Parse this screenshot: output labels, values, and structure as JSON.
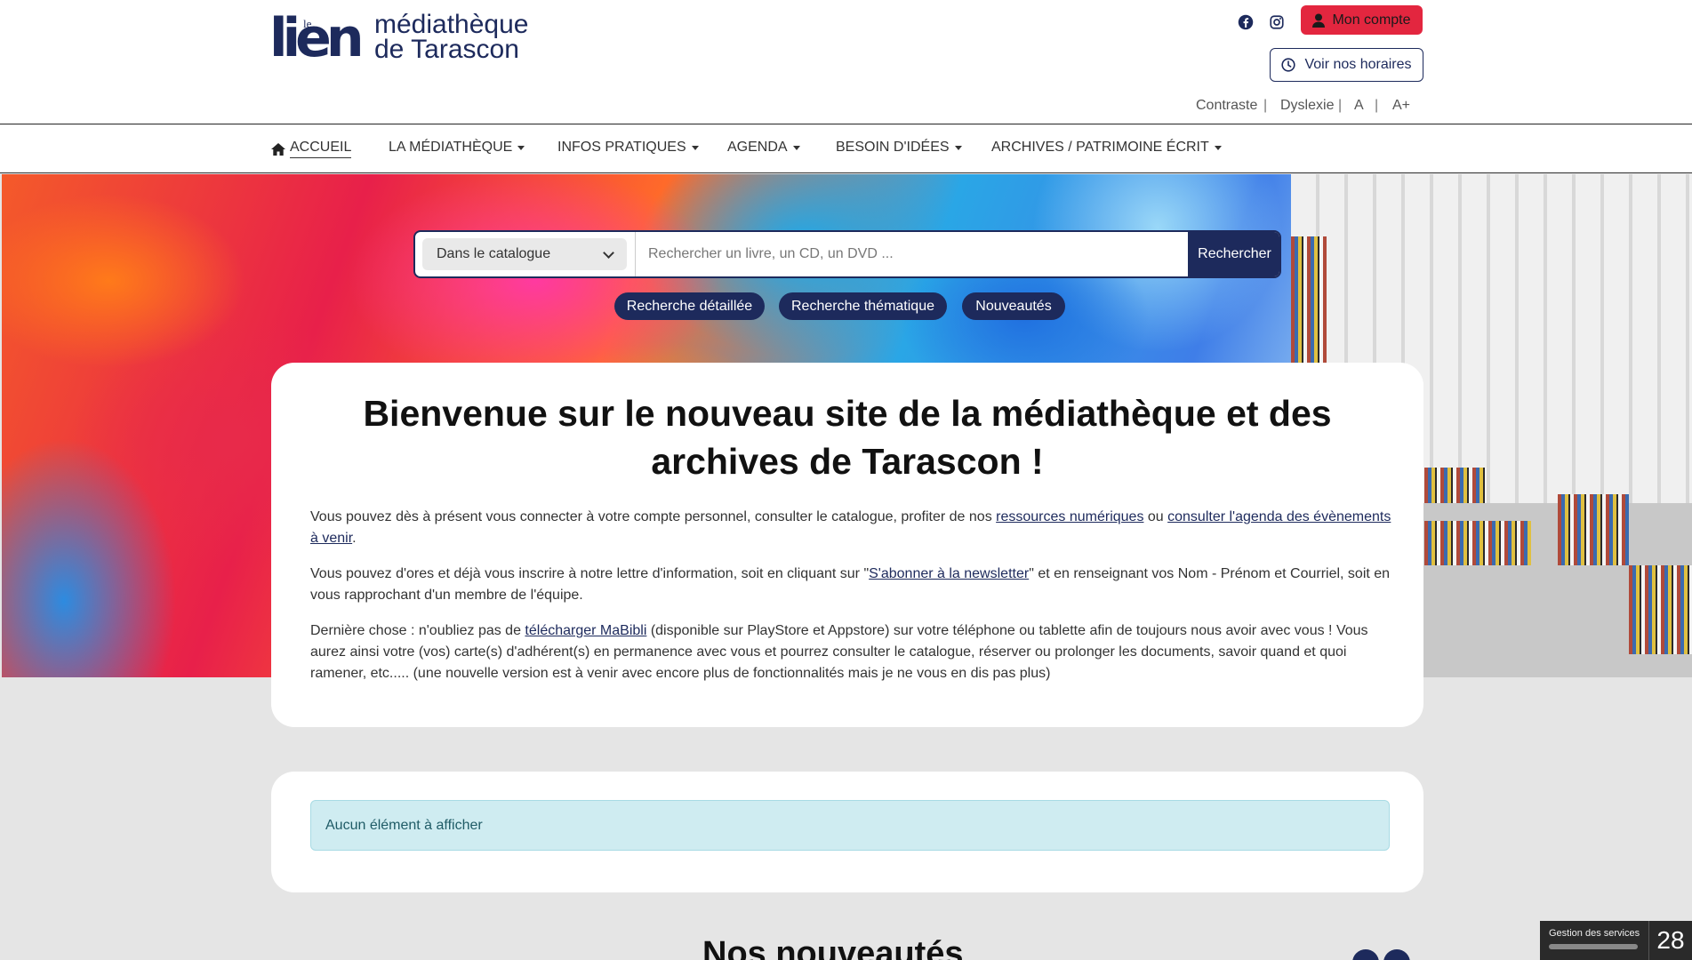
{
  "header": {
    "logo": {
      "le": "le",
      "lien": "lien",
      "line1": "médiathèque",
      "line2": "de Tarascon"
    },
    "social": [
      {
        "icon": "facebook-icon"
      },
      {
        "icon": "instagram-icon"
      }
    ],
    "account_label": "Mon compte",
    "hours_label": "Voir nos horaires",
    "accessibility": {
      "contrast": "Contraste",
      "dyslexia": "Dyslexie",
      "font_small": "A",
      "font_large": "A+",
      "separator": "|"
    }
  },
  "nav": {
    "items": [
      {
        "label": "ACCUEIL",
        "active": true
      },
      {
        "label": "LA MÉDIATHÈQUE"
      },
      {
        "label": "INFOS PRATIQUES"
      },
      {
        "label": "AGENDA"
      },
      {
        "label": "BESOIN D'IDÉES"
      },
      {
        "label": "ARCHIVES / PATRIMOINE ÉCRIT"
      }
    ]
  },
  "search": {
    "scope": "Dans le catalogue",
    "placeholder": "Rechercher un livre, un CD, un DVD ...",
    "button": "Rechercher",
    "pills": [
      "Recherche détaillée",
      "Recherche thématique",
      "Nouveautés"
    ]
  },
  "welcome": {
    "title": "Bienvenue sur le nouveau site de la médiathèque et des archives de Tarascon !",
    "p1": {
      "a": "Vous pouvez dès à présent vous connecter à votre compte personnel, consulter le catalogue, profiter de nos ",
      "link1": "ressources numériques",
      "b": " ou ",
      "link2": "consulter l'agenda des évènements à venir",
      "c": "."
    },
    "p2": {
      "a": "Vous pouvez d'ores et déjà vous inscrire à notre lettre d'information, soit en cliquant sur \"",
      "link": "S'abonner à la newsletter",
      "b": "\" et en renseignant vos Nom - Prénom et Courriel, soit en vous rapprochant d'un membre de l'équipe."
    },
    "p3": {
      "a": "Dernière chose : n'oubliez pas de ",
      "link": "télécharger MaBibli",
      "b": " (disponible sur PlayStore et Appstore) sur votre téléphone ou tablette afin de toujours nous avoir avec vous ! Vous aurez ainsi votre (vos) carte(s) d'adhérent(s) en permanence avec vous et pourrez consulter le catalogue, réserver ou prolonger les documents, savoir quand et quoi ramener, etc..... (une nouvelle version est à venir avec encore plus de fonctionnalités mais je ne vous en dis pas plus)"
    }
  },
  "empty_notice": "Aucun élément à afficher",
  "nouveautes_title": "Nos nouveautés",
  "services": {
    "label": "Gestion des services",
    "count": "28"
  },
  "colors": {
    "brand_navy": "#1d2a5c",
    "account_red": "#e3263f",
    "alert_bg": "#cfecf1"
  }
}
